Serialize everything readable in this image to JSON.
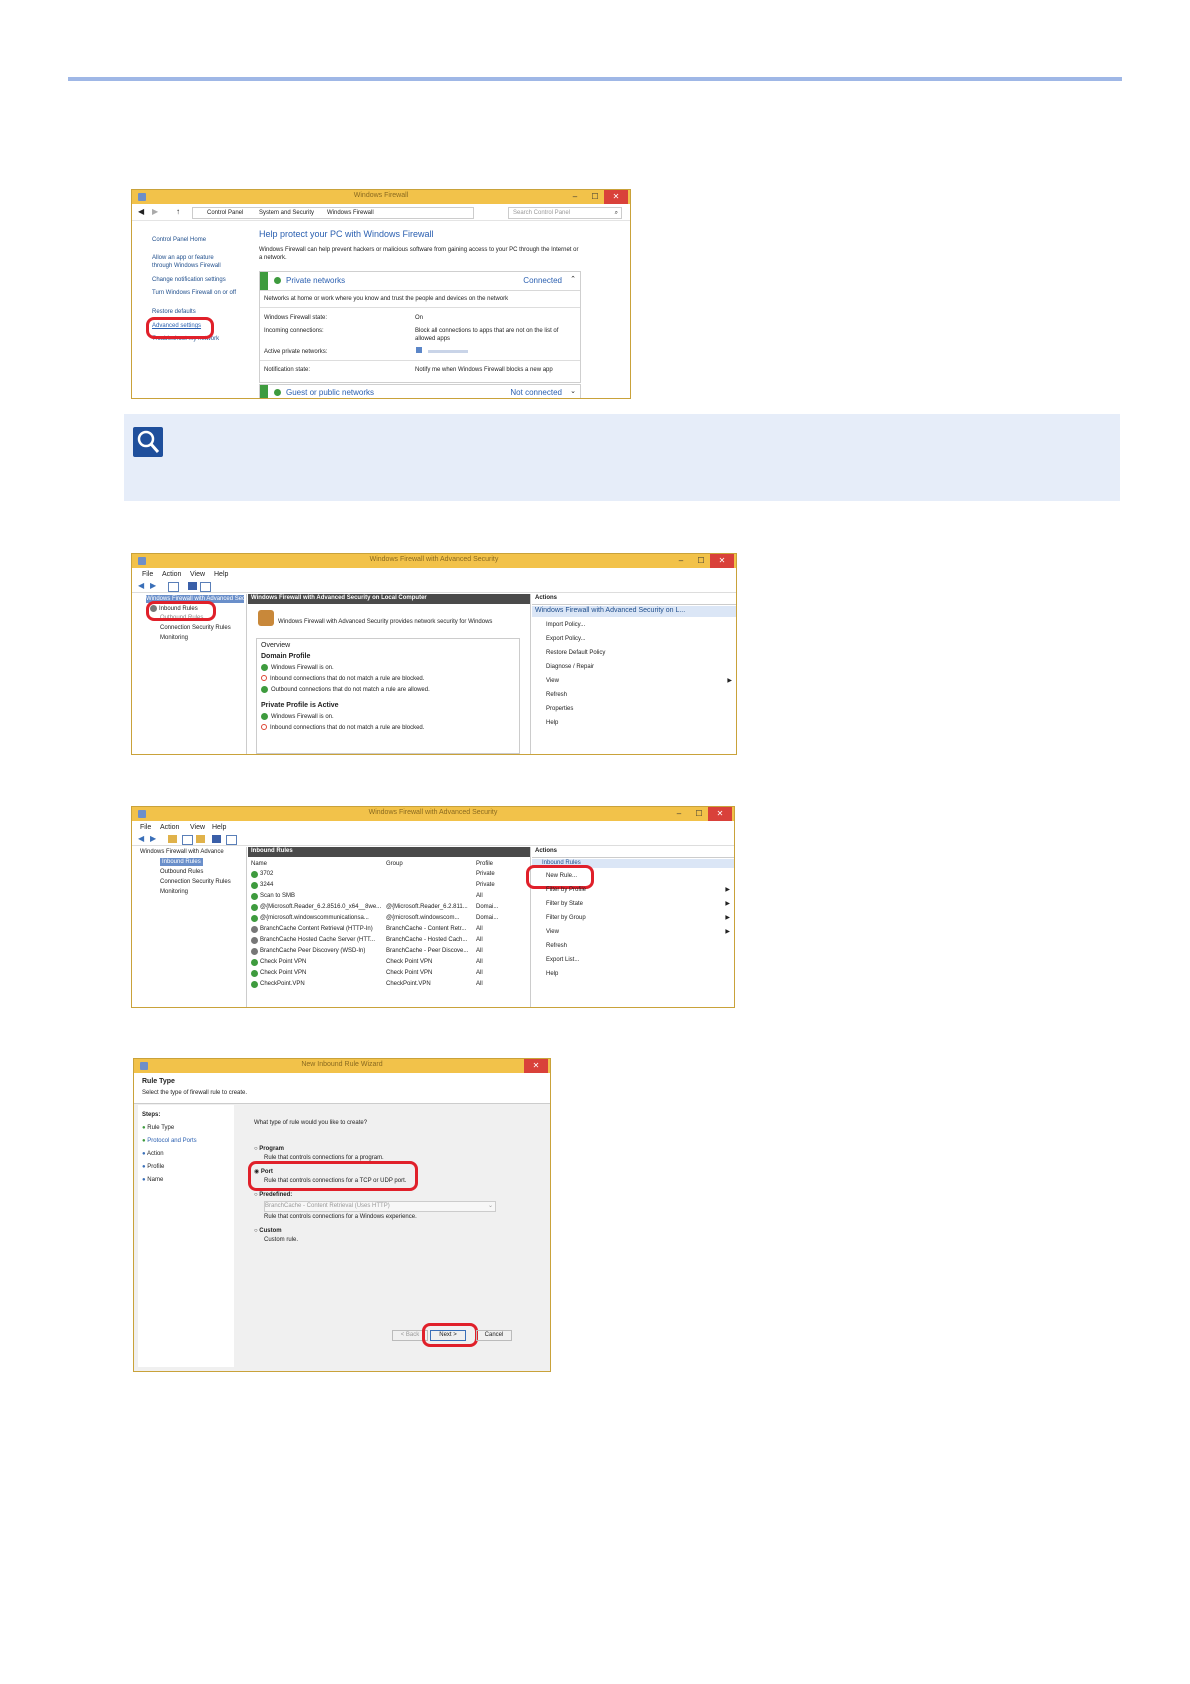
{
  "win1": {
    "title": "Windows Firewall",
    "address": [
      "Control Panel",
      "System and Security",
      "Windows Firewall"
    ],
    "search_placeholder": "Search Control Panel",
    "sidebar": {
      "home": "Control Panel Home",
      "allow_app": "Allow an app or feature through Windows Firewall",
      "change_notif": "Change notification settings",
      "turn_on_off": "Turn Windows Firewall on or off",
      "restore": "Restore defaults",
      "advanced": "Advanced settings",
      "troubleshoot": "Troubleshoot my network"
    },
    "heading": "Help protect your PC with Windows Firewall",
    "intro": "Windows Firewall can help prevent hackers or malicious software from gaining access to your PC through the Internet or a network.",
    "private_title": "Private networks",
    "private_status": "Connected",
    "private_desc": "Networks at home or work where you know and trust the people and devices on the network",
    "rows": [
      {
        "k": "Windows Firewall state:",
        "v": "On"
      },
      {
        "k": "Incoming connections:",
        "v": "Block all connections to apps that are not on the list of allowed apps"
      },
      {
        "k": "Active private networks:",
        "v": ""
      },
      {
        "k": "Notification state:",
        "v": "Notify me when Windows Firewall blocks a new app"
      }
    ],
    "guest_title": "Guest or public networks",
    "guest_status": "Not connected"
  },
  "win2": {
    "title": "Windows Firewall with Advanced Security",
    "menu": [
      "File",
      "Action",
      "View",
      "Help"
    ],
    "tree": {
      "root": "Windows Firewall with Advanced Security",
      "inbound": "Inbound Rules",
      "outbound": "Outbound Rules",
      "connsec": "Connection Security Rules",
      "monitoring": "Monitoring"
    },
    "center_header": "Windows Firewall with Advanced Security on Local Computer",
    "center_intro": "Windows Firewall with Advanced Security provides network security for Windows",
    "overview": "Overview",
    "domain_profile": "Domain Profile",
    "domain_items": [
      "Windows Firewall is on.",
      "Inbound connections that do not match a rule are blocked.",
      "Outbound connections that do not match a rule are allowed."
    ],
    "private_profile": "Private Profile is Active",
    "private_items": [
      "Windows Firewall is on.",
      "Inbound connections that do not match a rule are blocked."
    ],
    "actions_header": "Actions",
    "actions_sel": "Windows Firewall with Advanced Security on L...",
    "actions": [
      "Import Policy...",
      "Export Policy...",
      "Restore Default Policy",
      "Diagnose / Repair",
      "View",
      "Refresh",
      "Properties",
      "Help"
    ]
  },
  "win3": {
    "title": "Windows Firewall with Advanced Security",
    "menu": [
      "File",
      "Action",
      "View",
      "Help"
    ],
    "tree": {
      "root": "Windows Firewall with Advance",
      "inbound": "Inbound Rules",
      "outbound": "Outbound Rules",
      "connsec": "Connection Security Rules",
      "monitoring": "Monitoring"
    },
    "center_header": "Inbound Rules",
    "cols": [
      "Name",
      "Group",
      "Profile"
    ],
    "rules": [
      {
        "name": "3702",
        "group": "",
        "profile": "Private"
      },
      {
        "name": "3244",
        "group": "",
        "profile": "Private"
      },
      {
        "name": "Scan to SMB",
        "group": "",
        "profile": "All"
      },
      {
        "name": "@{Microsoft.Reader_6.2.8516.0_x64__8we...",
        "group": "@{Microsoft.Reader_6.2.811...",
        "profile": "Domai..."
      },
      {
        "name": "@{microsoft.windowscommunicationsa...",
        "group": "@{microsoft.windowscom...",
        "profile": "Domai..."
      },
      {
        "name": "BranchCache Content Retrieval (HTTP-In)",
        "group": "BranchCache - Content Retr...",
        "profile": "All"
      },
      {
        "name": "BranchCache Hosted Cache Server (HTT...",
        "group": "BranchCache - Hosted Cach...",
        "profile": "All"
      },
      {
        "name": "BranchCache Peer Discovery (WSD-In)",
        "group": "BranchCache - Peer Discove...",
        "profile": "All"
      },
      {
        "name": "Check Point VPN",
        "group": "Check Point VPN",
        "profile": "All"
      },
      {
        "name": "Check Point VPN",
        "group": "Check Point VPN",
        "profile": "All"
      },
      {
        "name": "CheckPoint.VPN",
        "group": "CheckPoint.VPN",
        "profile": "All"
      }
    ],
    "actions_header": "Actions",
    "actions_sel": "Inbound Rules",
    "actions": [
      "New Rule...",
      "Filter by Profile",
      "Filter by State",
      "Filter by Group",
      "View",
      "Refresh",
      "Export List...",
      "Help"
    ]
  },
  "win4": {
    "title": "New Inbound Rule Wizard",
    "rule_type": "Rule Type",
    "subtitle": "Select the type of firewall rule to create.",
    "steps_label": "Steps:",
    "steps": [
      "Rule Type",
      "Protocol and Ports",
      "Action",
      "Profile",
      "Name"
    ],
    "question": "What type of rule would you like to create?",
    "options": [
      {
        "label": "Program",
        "desc": "Rule that controls connections for a program."
      },
      {
        "label": "Port",
        "desc": "Rule that controls connections for a TCP or UDP port."
      },
      {
        "label": "Predefined:",
        "desc": "Rule that controls connections for a Windows experience."
      },
      {
        "label": "Custom",
        "desc": "Custom rule."
      }
    ],
    "predefined_value": "BranchCache - Content Retrieval (Uses HTTP)",
    "back": "< Back",
    "next": "Next >",
    "cancel": "Cancel"
  }
}
